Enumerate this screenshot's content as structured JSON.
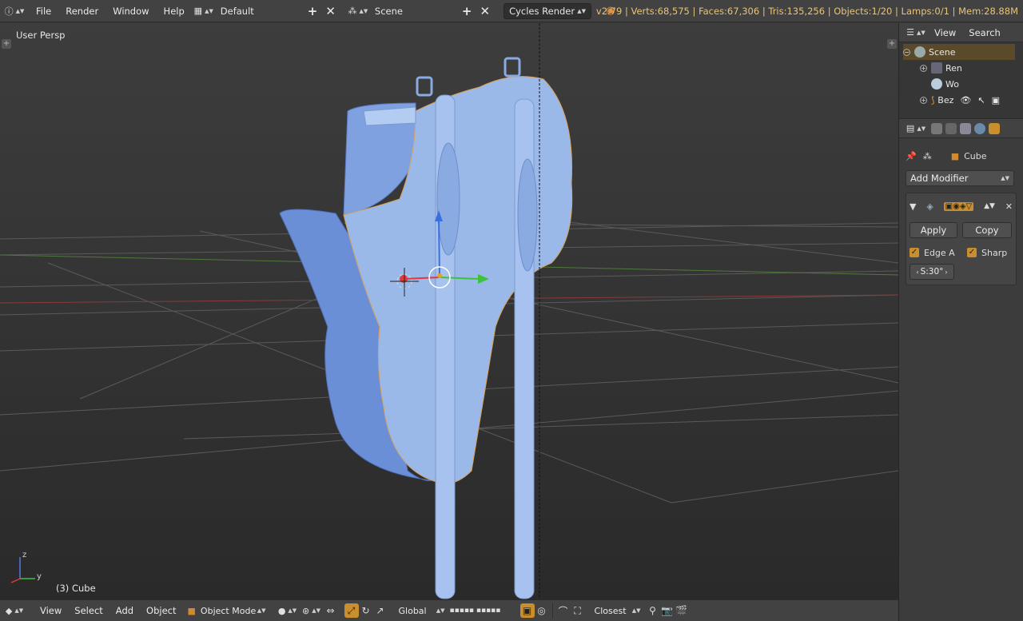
{
  "topbar": {
    "menus": [
      "File",
      "Render",
      "Window",
      "Help"
    ],
    "layout_name": "Default",
    "scene_name": "Scene",
    "render_engine": "Cycles Render",
    "stats": "v2.79 | Verts:68,575 | Faces:67,306 | Tris:135,256 | Objects:1/20 | Lamps:0/1 | Mem:28.88M"
  },
  "viewport": {
    "view_label": "User Persp",
    "object_label": "(3) Cube",
    "axis_z": "z",
    "axis_y": "y"
  },
  "bottombar": {
    "menus": [
      "View",
      "Select",
      "Add",
      "Object"
    ],
    "mode": "Object Mode",
    "orientation": "Global",
    "snap_target": "Closest"
  },
  "outliner": {
    "menus": [
      "View",
      "Search"
    ],
    "rows": [
      "Scene",
      "Ren",
      "Wo",
      "Bez"
    ]
  },
  "properties": {
    "object_name": "Cube",
    "add_modifier": "Add Modifier",
    "apply": "Apply",
    "copy": "Copy",
    "edge_a": "Edge A",
    "sharp": "Sharp",
    "split_angle": "S:30°"
  },
  "colors": {
    "accent": "#c98e2e",
    "mesh": "#9ab8e8",
    "stats": "#e8c47a"
  }
}
